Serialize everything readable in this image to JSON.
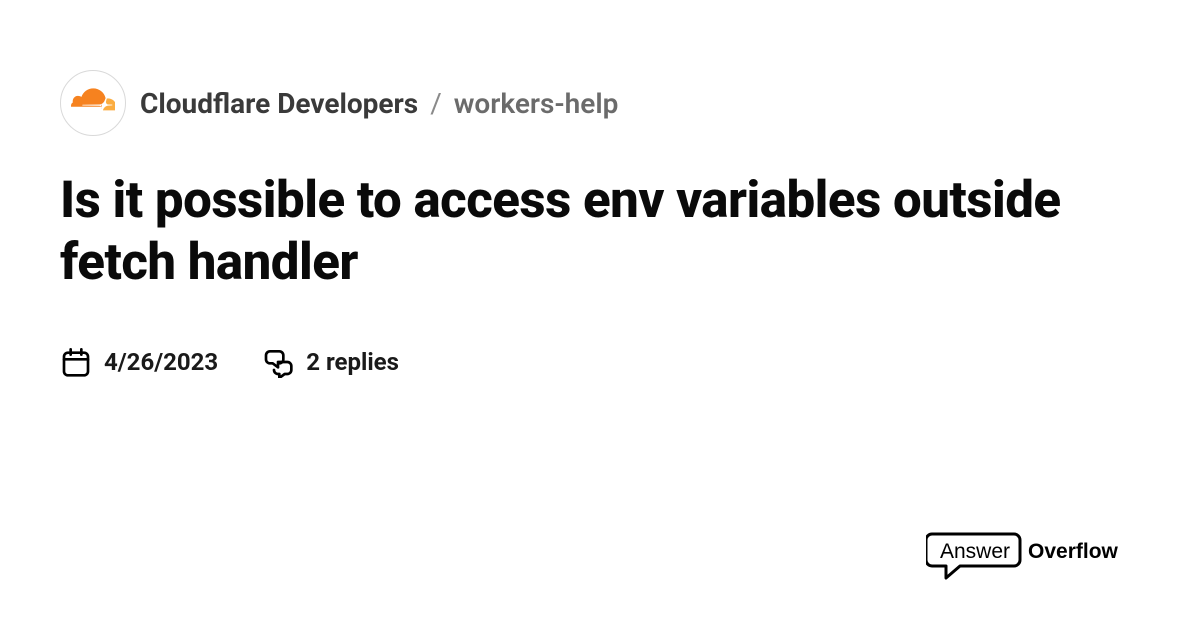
{
  "breadcrumb": {
    "community": "Cloudflare Developers",
    "separator": "/",
    "channel": "workers-help"
  },
  "title": "Is it possible to access env variables outside fetch handler",
  "meta": {
    "date": "4/26/2023",
    "replies": "2 replies"
  },
  "brand": {
    "name_left": "Answer",
    "name_right": "Overflow"
  }
}
